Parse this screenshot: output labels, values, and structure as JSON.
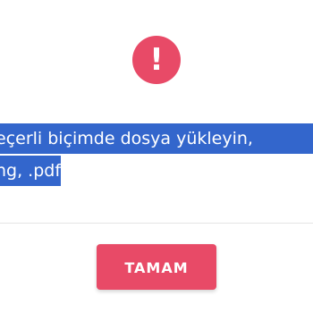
{
  "dialog": {
    "icon": "exclamation-icon",
    "icon_glyph": "!",
    "message_line1": "eçerli biçimde dosya yükleyin,",
    "message_line2": "ng, .pdf",
    "ok_label": "TAMAM"
  },
  "colors": {
    "accent": "#e84a67",
    "selection": "#3366cc",
    "background": "#ffffff",
    "divider": "#e4e4e4"
  }
}
